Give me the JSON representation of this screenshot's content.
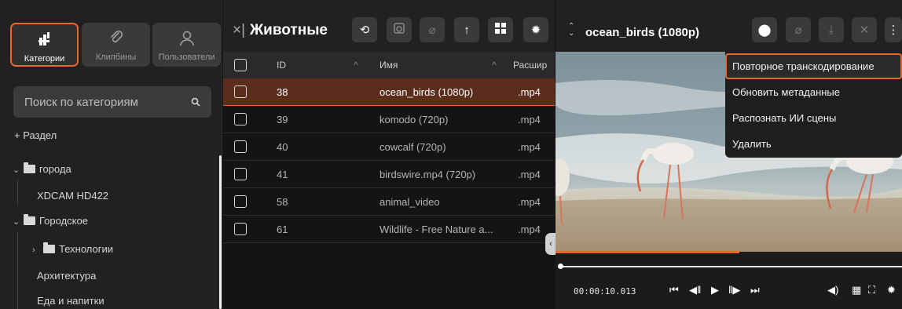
{
  "sidebar": {
    "tabs": [
      {
        "label": "Категории",
        "icon": "categories-icon",
        "active": true
      },
      {
        "label": "Клипбины",
        "icon": "paperclip-icon",
        "active": false
      },
      {
        "label": "Пользователи",
        "icon": "user-icon",
        "active": false
      }
    ],
    "search_placeholder": "Поиск по категориям",
    "add_section_label": "+ Раздел",
    "tree": [
      {
        "label": "города",
        "expanded": true,
        "folder": true
      },
      {
        "label": "XDCAM HD422",
        "child": true
      },
      {
        "label": "Городское",
        "expanded": true,
        "folder": true
      },
      {
        "label": "Технологии",
        "expanded": false,
        "folder": true,
        "child": true
      },
      {
        "label": "Архитектура",
        "child": true
      },
      {
        "label": "Еда и напитки",
        "child": true
      }
    ]
  },
  "clip_list": {
    "title": "Животные",
    "close_label": "×|",
    "columns": {
      "checkbox": "",
      "id": "ID",
      "name": "Имя",
      "ext": "Расшир"
    },
    "rows": [
      {
        "id": "38",
        "name": "ocean_birds (1080p)",
        "ext": ".mp4",
        "selected": true
      },
      {
        "id": "39",
        "name": "komodo (720p)",
        "ext": ".mp4"
      },
      {
        "id": "40",
        "name": "cowcalf (720p)",
        "ext": ".mp4"
      },
      {
        "id": "41",
        "name": "birdswire.mp4 (720p)",
        "ext": ".mp4"
      },
      {
        "id": "58",
        "name": "animal_video",
        "ext": ".mp4"
      },
      {
        "id": "61",
        "name": "Wildlife - Free Nature a...",
        "ext": ".mp4"
      }
    ]
  },
  "player": {
    "title": "ocean_birds (1080p)",
    "timecode": "00:00:10.013",
    "progress_fraction": 0.53
  },
  "context_menu": {
    "items": [
      {
        "label": "Повторное транскодирование",
        "highlighted": true
      },
      {
        "label": "Обновить метаданные"
      },
      {
        "label": "Распознать ИИ сцены"
      },
      {
        "label": "Удалить"
      }
    ]
  },
  "colors": {
    "accent": "#e8672a",
    "selected_row": "#5a2d1d"
  }
}
